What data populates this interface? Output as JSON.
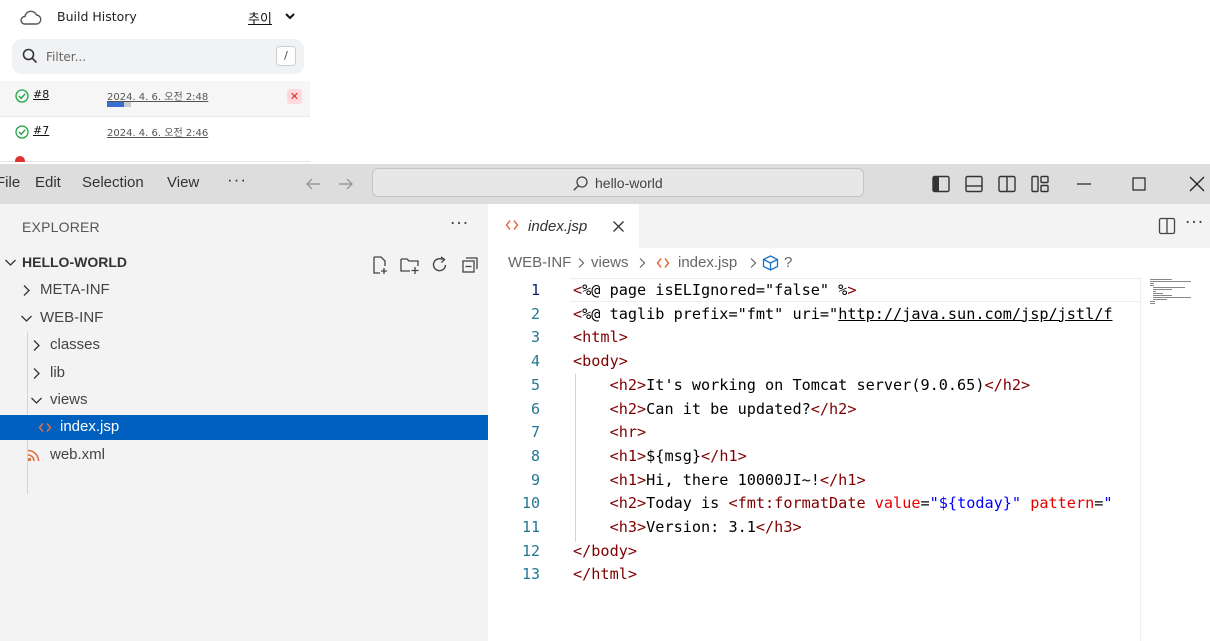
{
  "jenkins": {
    "title": "Build History",
    "trend_link": "추이",
    "filter_placeholder": "Filter...",
    "filter_shortcut": "/",
    "builds": [
      {
        "number": "#8",
        "date": "2024. 4. 6. 오전 2:48",
        "progress": 0.7,
        "status": "running"
      },
      {
        "number": "#7",
        "date": "2024. 4. 6. 오전 2:46",
        "status": "success"
      }
    ]
  },
  "menu": {
    "file": "File",
    "edit": "Edit",
    "selection": "Selection",
    "view": "View",
    "more": "···"
  },
  "command_center": {
    "text": "hello-world"
  },
  "explorer": {
    "title": "EXPLORER",
    "more": "···",
    "workspace": "HELLO-WORLD",
    "tree": [
      {
        "label": "META-INF",
        "type": "folder",
        "expanded": false
      },
      {
        "label": "WEB-INF",
        "type": "folder",
        "expanded": true
      },
      {
        "label": "classes",
        "type": "folder",
        "expanded": false
      },
      {
        "label": "lib",
        "type": "folder",
        "expanded": false
      },
      {
        "label": "views",
        "type": "folder",
        "expanded": true
      },
      {
        "label": "index.jsp",
        "type": "file",
        "selected": true
      },
      {
        "label": "web.xml",
        "type": "file"
      }
    ]
  },
  "editor": {
    "tab_label": "index.jsp",
    "more": "···",
    "breadcrumb": [
      "WEB-INF",
      "views",
      "index.jsp",
      "?"
    ],
    "active_line": 1,
    "lines": [
      {
        "n": "1",
        "segs": [
          [
            "tag",
            "<"
          ],
          [
            "text",
            "%@ page isELIgnored=\"false\" %"
          ],
          [
            "tag",
            ">"
          ]
        ]
      },
      {
        "n": "2",
        "segs": [
          [
            "tag",
            "<"
          ],
          [
            "text",
            "%@ taglib prefix=\"fmt\" uri=\""
          ],
          [
            "link",
            "http://java.sun.com/jsp/jstl/f"
          ]
        ]
      },
      {
        "n": "3",
        "segs": [
          [
            "tag",
            "<html>"
          ]
        ]
      },
      {
        "n": "4",
        "segs": [
          [
            "tag",
            "<body>"
          ]
        ]
      },
      {
        "n": "5",
        "segs": [
          [
            "text",
            "    "
          ],
          [
            "tag",
            "<h2>"
          ],
          [
            "text",
            "It's working on Tomcat server(9.0.65)"
          ],
          [
            "tag",
            "</h2>"
          ]
        ]
      },
      {
        "n": "6",
        "segs": [
          [
            "text",
            "    "
          ],
          [
            "tag",
            "<h2>"
          ],
          [
            "text",
            "Can it be updated?"
          ],
          [
            "tag",
            "</h2>"
          ]
        ]
      },
      {
        "n": "7",
        "segs": [
          [
            "text",
            "    "
          ],
          [
            "tag",
            "<hr>"
          ]
        ]
      },
      {
        "n": "8",
        "segs": [
          [
            "text",
            "    "
          ],
          [
            "tag",
            "<h1>"
          ],
          [
            "text",
            "${msg}"
          ],
          [
            "tag",
            "</h1>"
          ]
        ]
      },
      {
        "n": "9",
        "segs": [
          [
            "text",
            "    "
          ],
          [
            "tag",
            "<h1>"
          ],
          [
            "text",
            "Hi, there 10000JI~!"
          ],
          [
            "tag",
            "</h1>"
          ]
        ]
      },
      {
        "n": "10",
        "segs": [
          [
            "text",
            "    "
          ],
          [
            "tag",
            "<h2>"
          ],
          [
            "text",
            "Today is "
          ],
          [
            "tag",
            "<fmt:formatDate "
          ],
          [
            "attr",
            "value"
          ],
          [
            "text",
            "="
          ],
          [
            "str",
            "\"${today}\""
          ],
          [
            "text",
            " "
          ],
          [
            "attr",
            "pattern"
          ],
          [
            "text",
            "="
          ],
          [
            "str",
            "\""
          ]
        ]
      },
      {
        "n": "11",
        "segs": [
          [
            "text",
            "    "
          ],
          [
            "tag",
            "<h3>"
          ],
          [
            "text",
            "Version: 3.1"
          ],
          [
            "tag",
            "</h3>"
          ]
        ]
      },
      {
        "n": "12",
        "segs": [
          [
            "tag",
            "</body>"
          ]
        ]
      },
      {
        "n": "13",
        "segs": [
          [
            "tag",
            "</html>"
          ]
        ]
      }
    ]
  }
}
